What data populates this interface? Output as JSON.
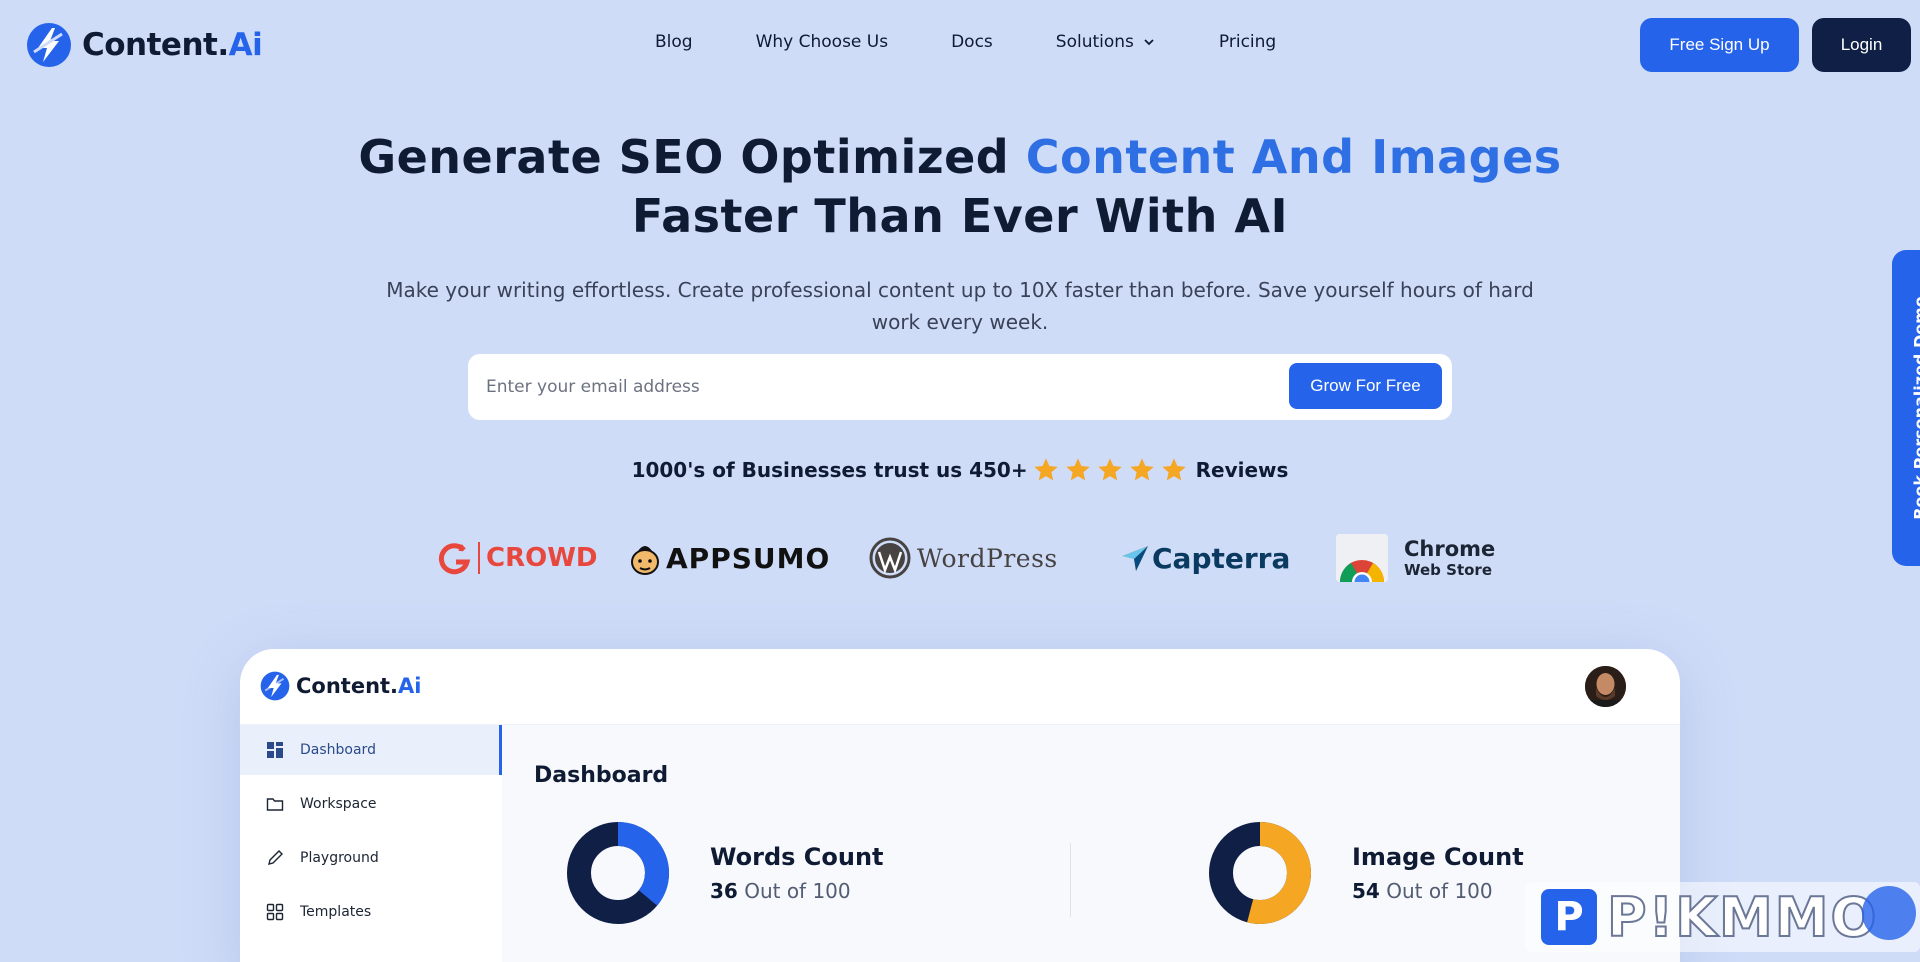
{
  "header": {
    "logo_text": "Content.",
    "logo_accent": "Ai",
    "nav": [
      {
        "label": "Blog"
      },
      {
        "label": "Why Choose Us"
      },
      {
        "label": "Docs"
      },
      {
        "label": "Solutions"
      },
      {
        "label": "Pricing"
      }
    ],
    "signup_label": "Free Sign Up",
    "login_label": "Login"
  },
  "hero": {
    "title_pre": "Generate SEO Optimized ",
    "title_highlight": "Content And Images",
    "title_post": " Faster Than Ever With AI",
    "subtitle": "Make your writing effortless. Create professional content up to 10X faster than before. Save yourself hours of hard work every week.",
    "email_placeholder": "Enter your email address",
    "cta_label": "Grow For Free",
    "trust_pre": "1000's of Businesses trust us 450+",
    "trust_post": "Reviews",
    "rating_stars": 5
  },
  "partners": {
    "g2": "CROWD",
    "appsumo": "APPSUMO",
    "wordpress": "WordPress",
    "capterra": "Capterra",
    "chrome_line1": "Chrome",
    "chrome_line2": "Web Store"
  },
  "dashboard": {
    "logo_text": "Content.",
    "logo_accent": "Ai",
    "sidebar": [
      {
        "label": "Dashboard",
        "icon": "grid-icon",
        "active": true
      },
      {
        "label": "Workspace",
        "icon": "folder-icon",
        "active": false
      },
      {
        "label": "Playground",
        "icon": "pencil-icon",
        "active": false
      },
      {
        "label": "Templates",
        "icon": "templates-icon",
        "active": false
      }
    ],
    "title": "Dashboard",
    "stats": [
      {
        "name": "Words Count",
        "value": "36",
        "suffix": "Out of 100",
        "fraction": 0.36,
        "color": "#2563eb"
      },
      {
        "name": "Image Count",
        "value": "54",
        "suffix": "Out of 100",
        "fraction": 0.54,
        "color": "#f5a623"
      }
    ]
  },
  "side_tab_label": "Book Personalized Demo",
  "watermark": "P!KMMO",
  "colors": {
    "background": "#cfdcf8",
    "primary": "#2563eb",
    "dark": "#0f1f45",
    "accent_text": "#2f6fe4",
    "star": "#f5a623"
  }
}
